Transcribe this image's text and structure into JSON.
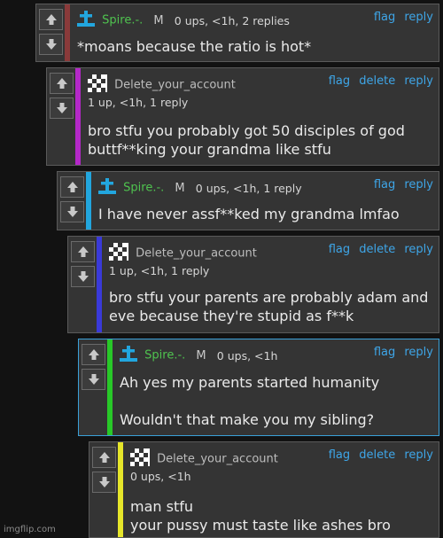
{
  "actions": {
    "flag": "flag",
    "delete": "delete",
    "reply": "reply"
  },
  "comments": [
    {
      "username": "Spire.-.",
      "flair": "M",
      "meta": "0 ups, <1h, 2 replies",
      "text": "*moans because the ratio is hot*",
      "stripe_color": "#8a3a3a",
      "icon": "cross-icon"
    },
    {
      "username": "Delete_your_account",
      "meta": "1 up, <1h, 1 reply",
      "text": "bro stfu you probably got 50 disciples of god\nbuttf**king your grandma like stfu",
      "stripe_color": "#b428c8",
      "icon": "checker-avatar-icon"
    },
    {
      "username": "Spire.-.",
      "flair": "M",
      "meta": "0 ups, <1h, 1 reply",
      "text": "I have never assf**ked my grandma lmfao",
      "stripe_color": "#22a6de",
      "icon": "cross-icon"
    },
    {
      "username": "Delete_your_account",
      "meta": "1 up, <1h, 1 reply",
      "text": "bro stfu your parents are probably adam and\neve because they're stupid as f**k",
      "stripe_color": "#3a3ad8",
      "icon": "checker-avatar-icon"
    },
    {
      "username": "Spire.-.",
      "flair": "M",
      "meta": "0 ups, <1h",
      "text": "Ah yes my parents started humanity\n\nWouldn't that make you my sibling?",
      "stripe_color": "#28c828",
      "icon": "cross-icon"
    },
    {
      "username": "Delete_your_account",
      "meta": "0 ups, <1h",
      "text": "man stfu\nyour pussy must taste like ashes bro",
      "stripe_color": "#e6e62a",
      "icon": "checker-avatar-icon"
    }
  ],
  "watermark": "imgflip.com",
  "colors": {
    "link": "#3ea6e8",
    "spire_name": "#4fc34f",
    "highlight_border": "#3aa0d8"
  }
}
